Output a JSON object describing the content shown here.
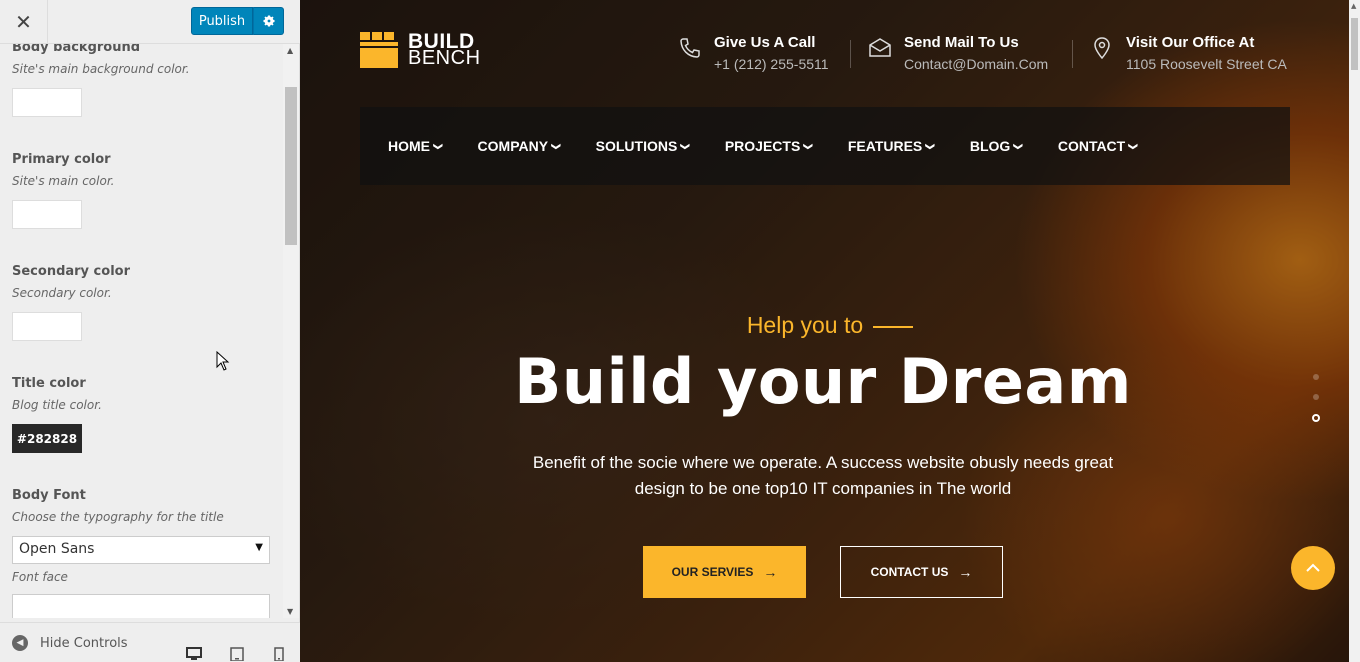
{
  "customizer": {
    "close_symbol": "✕",
    "publish_label": "Publish",
    "fields": [
      {
        "title": "Body background",
        "desc": "Site's main background color.",
        "value": ""
      },
      {
        "title": "Primary color",
        "desc": "Site's main color.",
        "value": ""
      },
      {
        "title": "Secondary color",
        "desc": "Secondary color.",
        "value": ""
      },
      {
        "title": "Title color",
        "desc": "Blog title color.",
        "value": "#282828"
      }
    ],
    "font": {
      "title": "Body Font",
      "desc": "Choose the typography for the title",
      "selected": "Open Sans",
      "face_label": "Font face"
    },
    "hide_controls_label": "Hide Controls",
    "icons": {
      "close": "close-icon",
      "settings": "gear-icon",
      "collapse": "collapse-arrow-icon",
      "desktop": "desktop-icon",
      "tablet": "tablet-icon",
      "mobile": "mobile-icon"
    }
  },
  "site": {
    "logo": {
      "line1": "BUILD",
      "line2": "BENCH"
    },
    "contacts": [
      {
        "icon": "phone-icon",
        "title": "Give Us A Call",
        "value": "+1 (212) 255-5511"
      },
      {
        "icon": "mail-icon",
        "title": "Send Mail To Us",
        "value": "Contact@Domain.Com"
      },
      {
        "icon": "location-pin-icon",
        "title": "Visit Our Office At",
        "value": "1105 Roosevelt Street CA"
      }
    ],
    "nav": [
      "HOME",
      "COMPANY",
      "SOLUTIONS",
      "PROJECTS",
      "FEATURES",
      "BLOG",
      "CONTACT"
    ],
    "hero": {
      "subtitle": "Help you to",
      "title": "Build your Dream",
      "description": "Benefit of the socie where we operate. A success website obusly needs great design to be one top10 IT companies in The world",
      "primary_button": "OUR SERVIES",
      "secondary_button": "CONTACT US"
    },
    "colors": {
      "accent": "#fbb62b",
      "nav_bg": "#111111",
      "publish": "#0085ba"
    }
  }
}
